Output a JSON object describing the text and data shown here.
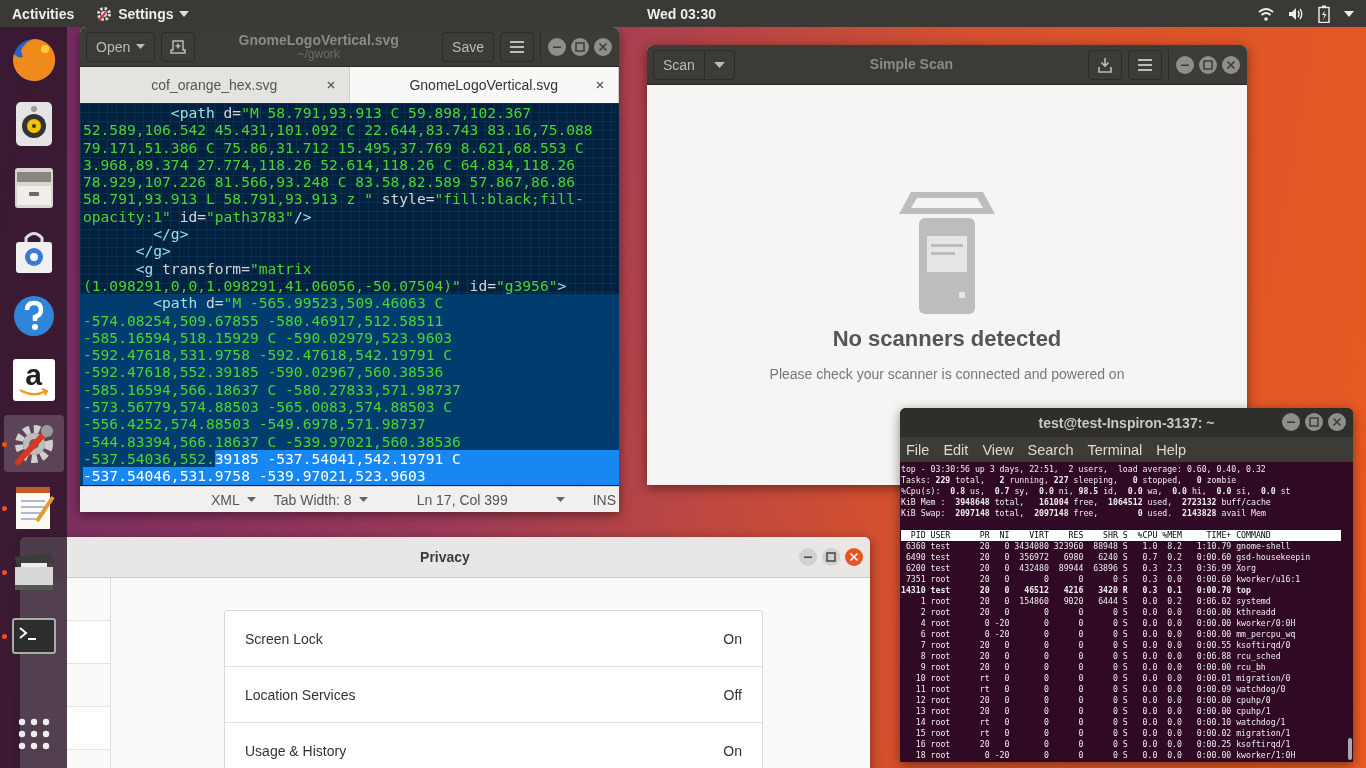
{
  "top_bar": {
    "activities": "Activities",
    "app_menu": "Settings",
    "clock": "Wed 03:30"
  },
  "dock": [
    {
      "kind": "firefox",
      "running": false,
      "selected": false
    },
    {
      "kind": "rhythmbox",
      "running": false,
      "selected": false
    },
    {
      "kind": "files",
      "running": false,
      "selected": false
    },
    {
      "kind": "software",
      "running": false,
      "selected": false
    },
    {
      "kind": "help",
      "running": false,
      "selected": false
    },
    {
      "kind": "amazon",
      "running": false,
      "selected": false,
      "glyph": "a"
    },
    {
      "kind": "settings",
      "running": true,
      "selected": true
    },
    {
      "kind": "editor",
      "running": true,
      "selected": false
    },
    {
      "kind": "scanner",
      "running": true,
      "selected": false
    },
    {
      "kind": "terminal",
      "running": true,
      "selected": false
    },
    {
      "kind": "apps",
      "running": false,
      "selected": false
    }
  ],
  "text_editor": {
    "open_button": "Open",
    "title": "GnomeLogoVertical.svg",
    "subtitle": "~/gwork",
    "save_button": "Save",
    "tabs": [
      {
        "label": "cof_orange_hex.svg",
        "selected": false
      },
      {
        "label": "GnomeLogoVertical.svg",
        "selected": true
      }
    ],
    "lines": [
      {
        "current": false,
        "segments": [
          {
            "kind": "tag",
            "text": "          <path"
          },
          {
            "kind": "attr",
            "text": " d="
          },
          {
            "kind": "value",
            "text": "\"M 58.791,93.913 C 59.898,102.367"
          }
        ]
      },
      {
        "current": false,
        "segments": [
          {
            "kind": "value",
            "text": "52.589,106.542 45.431,101.092 C 22.644,83.743 83.16,75.088"
          }
        ]
      },
      {
        "current": false,
        "segments": [
          {
            "kind": "value",
            "text": "79.171,51.386 C 75.86,31.712 15.495,37.769 8.621,68.553 C"
          }
        ]
      },
      {
        "current": false,
        "segments": [
          {
            "kind": "value",
            "text": "3.968,89.374 27.774,118.26 52.614,118.26 C 64.834,118.26"
          }
        ]
      },
      {
        "current": false,
        "segments": [
          {
            "kind": "value",
            "text": "78.929,107.226 81.566,93.248 C 83.58,82.589 57.867,86.86"
          }
        ]
      },
      {
        "current": false,
        "segments": [
          {
            "kind": "value",
            "text": "58.791,93.913 L 58.791,93.913 z \""
          },
          {
            "kind": "attr",
            "text": " style="
          },
          {
            "kind": "value",
            "text": "\"fill:black;fill-"
          }
        ]
      },
      {
        "current": false,
        "segments": [
          {
            "kind": "value",
            "text": "opacity:1\""
          },
          {
            "kind": "attr",
            "text": " id="
          },
          {
            "kind": "value",
            "text": "\"path3783\""
          },
          {
            "kind": "tag",
            "text": "/>"
          }
        ]
      },
      {
        "current": false,
        "segments": [
          {
            "kind": "tag",
            "text": "        </g>"
          }
        ]
      },
      {
        "current": false,
        "segments": [
          {
            "kind": "tag",
            "text": "      </g>"
          }
        ]
      },
      {
        "current": false,
        "segments": [
          {
            "kind": "tag",
            "text": "      <g"
          },
          {
            "kind": "attr",
            "text": " transform="
          },
          {
            "kind": "value",
            "text": "\"matrix"
          }
        ]
      },
      {
        "current": false,
        "segments": [
          {
            "kind": "value",
            "text": "(1.098291,0,0,1.098291,41.06056,-50.07504)\""
          },
          {
            "kind": "attr",
            "text": " id="
          },
          {
            "kind": "value",
            "text": "\"g3956\""
          },
          {
            "kind": "tag",
            "text": ">"
          }
        ]
      },
      {
        "current": true,
        "segments": [
          {
            "kind": "tag",
            "text": "        <path"
          },
          {
            "kind": "attr",
            "text": " d="
          },
          {
            "kind": "value",
            "text": "\"M -565.99523,509.46063 C"
          }
        ]
      },
      {
        "current": true,
        "segments": [
          {
            "kind": "value",
            "text": "-574.08254,509.67855 -580.46917,512.58511"
          }
        ]
      },
      {
        "current": true,
        "segments": [
          {
            "kind": "value",
            "text": "-585.16594,518.15929 C -590.02979,523.9603"
          }
        ]
      },
      {
        "current": true,
        "segments": [
          {
            "kind": "value",
            "text": "-592.47618,531.9758 -592.47618,542.19791 C"
          }
        ]
      },
      {
        "current": true,
        "segments": [
          {
            "kind": "value",
            "text": "-592.47618,552.39185 -590.02967,560.38536"
          }
        ]
      },
      {
        "current": true,
        "segments": [
          {
            "kind": "value",
            "text": "-585.16594,566.18637 C -580.27833,571.98737"
          }
        ]
      },
      {
        "current": true,
        "segments": [
          {
            "kind": "value",
            "text": "-573.56779,574.88503 -565.0083,574.88503 C"
          }
        ]
      },
      {
        "current": true,
        "segments": [
          {
            "kind": "value",
            "text": "-556.4252,574.88503 -549.6978,571.98737"
          }
        ]
      },
      {
        "current": true,
        "segments": [
          {
            "kind": "value",
            "text": "-544.83394,566.18637 C -539.97021,560.38536"
          }
        ]
      },
      {
        "current": true,
        "segments": [
          {
            "kind": "value",
            "text": "-537.54036,552."
          },
          {
            "kind": "selected",
            "text": "39185 -537.54041,542.19791 C"
          }
        ]
      },
      {
        "current": true,
        "segments": [
          {
            "kind": "selected",
            "text": "-537.54046,531.9758 -539.97021,523.9603"
          }
        ]
      }
    ],
    "status": {
      "language": "XML",
      "tab_width": "Tab Width: 8",
      "position": "Ln 17, Col 399",
      "mode": "INS"
    }
  },
  "scanner": {
    "scan_button": "Scan",
    "title": "Simple Scan",
    "message": "No scanners detected",
    "hint": "Please check your scanner is connected and powered on"
  },
  "privacy": {
    "title": "Privacy",
    "rows": [
      {
        "label": "Screen Lock",
        "value": "On"
      },
      {
        "label": "Location Services",
        "value": "Off"
      },
      {
        "label": "Usage & History",
        "value": "On"
      }
    ]
  },
  "terminal": {
    "title": "test@test-Inspiron-3137: ~",
    "menu": [
      "File",
      "Edit",
      "View",
      "Search",
      "Terminal",
      "Help"
    ],
    "summary": [
      "top - 03:30:56 up 3 days, 22:51,  2 users,  load average: 0.60, 0.40, 0.32",
      "Tasks: **229** total,   **2** running, **227** sleeping,   **0** stopped,   **0** zombie",
      "%Cpu(s):  **0.8** us,  **0.7** sy,  **0.0** ni, **98.5** id,  **0.0** wa,  **0.0** hi,  **0.0** si,  **0.0** st",
      "KiB Mem :  **3948648** total,   **161004** free,  **1064512** used,  **2723132** buff/cache",
      "KiB Swap:  **2097148** total,  **2097148** free,        **0** used.  **2143828** avail Mem"
    ],
    "header": "  PID USER      PR  NI    VIRT    RES    SHR S  %CPU %MEM     TIME+ COMMAND",
    "processes": [
      {
        "text": " 6360 test      20   0 3434080 323960  88948 S   1.0  8.2   1:10.79 gnome-shell",
        "bold": false
      },
      {
        "text": " 6490 test      20   0  356972   6980   6240 S   0.7  0.2   0:00.60 gsd-housekeepin",
        "bold": false
      },
      {
        "text": " 6200 test      20   0  432480  89944  63896 S   0.3  2.3   0:36.99 Xorg",
        "bold": false
      },
      {
        "text": " 7351 root      20   0       0      0      0 S   0.3  0.0   0:00.60 kworker/u16:1",
        "bold": false
      },
      {
        "text": "14310 test      20   0   46512   4216   3420 R   0.3  0.1   0:00.70 top",
        "bold": true
      },
      {
        "text": "    1 root      20   0  154860   9020   6444 S   0.0  0.2   0:06.02 systemd",
        "bold": false
      },
      {
        "text": "    2 root      20   0       0      0      0 S   0.0  0.0   0:00.00 kthreadd",
        "bold": false
      },
      {
        "text": "    4 root       0 -20       0      0      0 S   0.0  0.0   0:00.00 kworker/0:0H",
        "bold": false
      },
      {
        "text": "    6 root       0 -20       0      0      0 S   0.0  0.0   0:00.00 mm_percpu_wq",
        "bold": false
      },
      {
        "text": "    7 root      20   0       0      0      0 S   0.0  0.0   0:00.55 ksoftirqd/0",
        "bold": false
      },
      {
        "text": "    8 root      20   0       0      0      0 S   0.0  0.0   0:06.88 rcu_sched",
        "bold": false
      },
      {
        "text": "    9 root      20   0       0      0      0 S   0.0  0.0   0:00.00 rcu_bh",
        "bold": false
      },
      {
        "text": "   10 root      rt   0       0      0      0 S   0.0  0.0   0:00.01 migration/0",
        "bold": false
      },
      {
        "text": "   11 root      rt   0       0      0      0 S   0.0  0.0   0:00.09 watchdog/0",
        "bold": false
      },
      {
        "text": "   12 root      20   0       0      0      0 S   0.0  0.0   0:00.00 cpuhp/0",
        "bold": false
      },
      {
        "text": "   13 root      20   0       0      0      0 S   0.0  0.0   0:00.00 cpuhp/1",
        "bold": false
      },
      {
        "text": "   14 root      rt   0       0      0      0 S   0.0  0.0   0:00.10 watchdog/1",
        "bold": false
      },
      {
        "text": "   15 root      rt   0       0      0      0 S   0.0  0.0   0:00.02 migration/1",
        "bold": false
      },
      {
        "text": "   16 root      20   0       0      0      0 S   0.0  0.0   0:00.25 ksoftirqd/1",
        "bold": false
      },
      {
        "text": "   18 root       0 -20       0      0      0 S   0.0  0.0   0:00.00 kworker/1:0H",
        "bold": false
      }
    ]
  }
}
